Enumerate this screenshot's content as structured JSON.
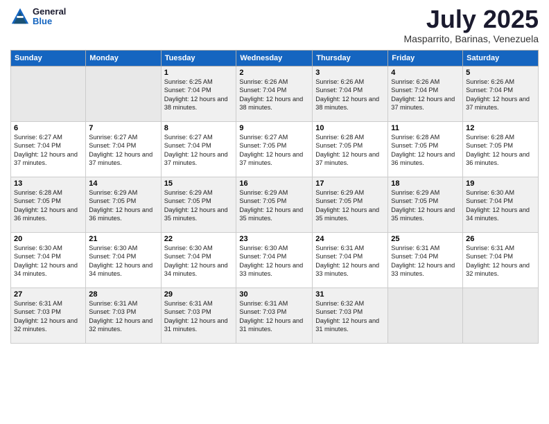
{
  "logo": {
    "general": "General",
    "blue": "Blue"
  },
  "header": {
    "month": "July 2025",
    "location": "Masparrito, Barinas, Venezuela"
  },
  "days_of_week": [
    "Sunday",
    "Monday",
    "Tuesday",
    "Wednesday",
    "Thursday",
    "Friday",
    "Saturday"
  ],
  "weeks": [
    [
      {
        "day": "",
        "info": ""
      },
      {
        "day": "",
        "info": ""
      },
      {
        "day": "1",
        "info": "Sunrise: 6:25 AM\nSunset: 7:04 PM\nDaylight: 12 hours and 38 minutes."
      },
      {
        "day": "2",
        "info": "Sunrise: 6:26 AM\nSunset: 7:04 PM\nDaylight: 12 hours and 38 minutes."
      },
      {
        "day": "3",
        "info": "Sunrise: 6:26 AM\nSunset: 7:04 PM\nDaylight: 12 hours and 38 minutes."
      },
      {
        "day": "4",
        "info": "Sunrise: 6:26 AM\nSunset: 7:04 PM\nDaylight: 12 hours and 37 minutes."
      },
      {
        "day": "5",
        "info": "Sunrise: 6:26 AM\nSunset: 7:04 PM\nDaylight: 12 hours and 37 minutes."
      }
    ],
    [
      {
        "day": "6",
        "info": "Sunrise: 6:27 AM\nSunset: 7:04 PM\nDaylight: 12 hours and 37 minutes."
      },
      {
        "day": "7",
        "info": "Sunrise: 6:27 AM\nSunset: 7:04 PM\nDaylight: 12 hours and 37 minutes."
      },
      {
        "day": "8",
        "info": "Sunrise: 6:27 AM\nSunset: 7:04 PM\nDaylight: 12 hours and 37 minutes."
      },
      {
        "day": "9",
        "info": "Sunrise: 6:27 AM\nSunset: 7:05 PM\nDaylight: 12 hours and 37 minutes."
      },
      {
        "day": "10",
        "info": "Sunrise: 6:28 AM\nSunset: 7:05 PM\nDaylight: 12 hours and 37 minutes."
      },
      {
        "day": "11",
        "info": "Sunrise: 6:28 AM\nSunset: 7:05 PM\nDaylight: 12 hours and 36 minutes."
      },
      {
        "day": "12",
        "info": "Sunrise: 6:28 AM\nSunset: 7:05 PM\nDaylight: 12 hours and 36 minutes."
      }
    ],
    [
      {
        "day": "13",
        "info": "Sunrise: 6:28 AM\nSunset: 7:05 PM\nDaylight: 12 hours and 36 minutes."
      },
      {
        "day": "14",
        "info": "Sunrise: 6:29 AM\nSunset: 7:05 PM\nDaylight: 12 hours and 36 minutes."
      },
      {
        "day": "15",
        "info": "Sunrise: 6:29 AM\nSunset: 7:05 PM\nDaylight: 12 hours and 35 minutes."
      },
      {
        "day": "16",
        "info": "Sunrise: 6:29 AM\nSunset: 7:05 PM\nDaylight: 12 hours and 35 minutes."
      },
      {
        "day": "17",
        "info": "Sunrise: 6:29 AM\nSunset: 7:05 PM\nDaylight: 12 hours and 35 minutes."
      },
      {
        "day": "18",
        "info": "Sunrise: 6:29 AM\nSunset: 7:05 PM\nDaylight: 12 hours and 35 minutes."
      },
      {
        "day": "19",
        "info": "Sunrise: 6:30 AM\nSunset: 7:04 PM\nDaylight: 12 hours and 34 minutes."
      }
    ],
    [
      {
        "day": "20",
        "info": "Sunrise: 6:30 AM\nSunset: 7:04 PM\nDaylight: 12 hours and 34 minutes."
      },
      {
        "day": "21",
        "info": "Sunrise: 6:30 AM\nSunset: 7:04 PM\nDaylight: 12 hours and 34 minutes."
      },
      {
        "day": "22",
        "info": "Sunrise: 6:30 AM\nSunset: 7:04 PM\nDaylight: 12 hours and 34 minutes."
      },
      {
        "day": "23",
        "info": "Sunrise: 6:30 AM\nSunset: 7:04 PM\nDaylight: 12 hours and 33 minutes."
      },
      {
        "day": "24",
        "info": "Sunrise: 6:31 AM\nSunset: 7:04 PM\nDaylight: 12 hours and 33 minutes."
      },
      {
        "day": "25",
        "info": "Sunrise: 6:31 AM\nSunset: 7:04 PM\nDaylight: 12 hours and 33 minutes."
      },
      {
        "day": "26",
        "info": "Sunrise: 6:31 AM\nSunset: 7:04 PM\nDaylight: 12 hours and 32 minutes."
      }
    ],
    [
      {
        "day": "27",
        "info": "Sunrise: 6:31 AM\nSunset: 7:03 PM\nDaylight: 12 hours and 32 minutes."
      },
      {
        "day": "28",
        "info": "Sunrise: 6:31 AM\nSunset: 7:03 PM\nDaylight: 12 hours and 32 minutes."
      },
      {
        "day": "29",
        "info": "Sunrise: 6:31 AM\nSunset: 7:03 PM\nDaylight: 12 hours and 31 minutes."
      },
      {
        "day": "30",
        "info": "Sunrise: 6:31 AM\nSunset: 7:03 PM\nDaylight: 12 hours and 31 minutes."
      },
      {
        "day": "31",
        "info": "Sunrise: 6:32 AM\nSunset: 7:03 PM\nDaylight: 12 hours and 31 minutes."
      },
      {
        "day": "",
        "info": ""
      },
      {
        "day": "",
        "info": ""
      }
    ]
  ]
}
